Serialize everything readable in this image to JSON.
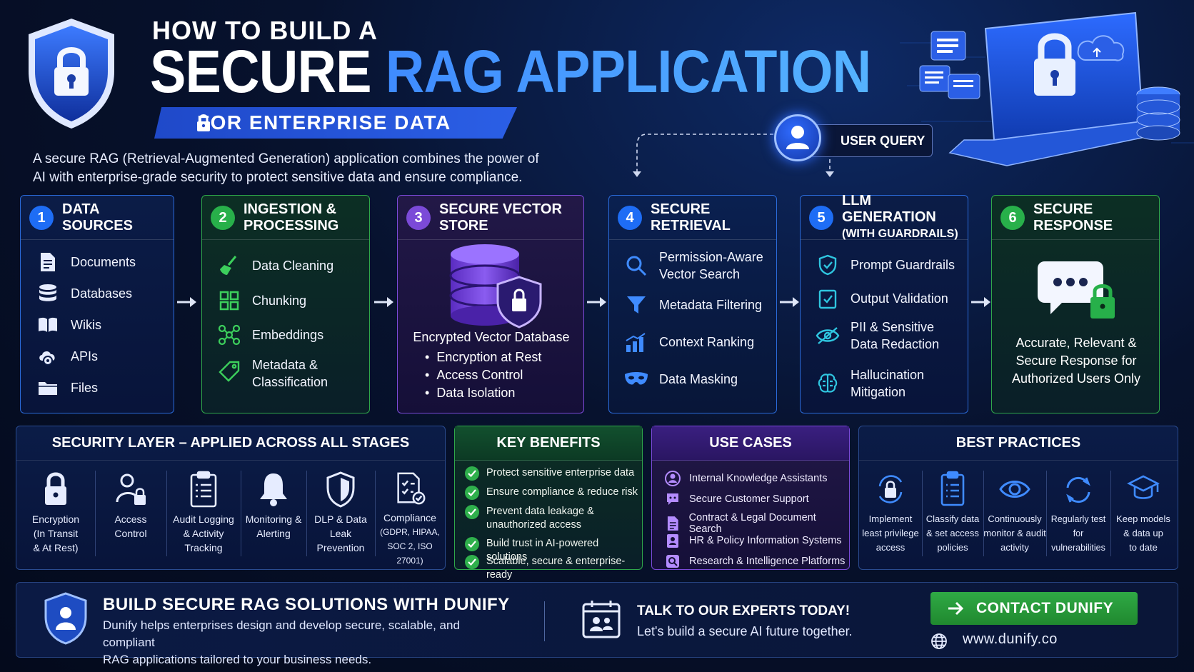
{
  "header": {
    "title_small": "HOW TO BUILD A",
    "title_word1": "SECURE",
    "title_word2": "RAG APPLICATION",
    "subtitle": "FOR ENTERPRISE DATA",
    "intro": "A secure RAG (Retrieval-Augmented Generation) application combines the power of AI with enterprise-grade security to protect sensitive data and ensure compliance."
  },
  "user_query": "USER QUERY",
  "stages": [
    {
      "num": "1",
      "title": "DATA SOURCES",
      "items": [
        "Documents",
        "Databases",
        "Wikis",
        "APIs",
        "Files"
      ]
    },
    {
      "num": "2",
      "title_line1": "INGESTION &",
      "title_line2": "PROCESSING",
      "items": [
        "Data Cleaning",
        "Chunking",
        "Embeddings",
        "Metadata &",
        "Classification"
      ]
    },
    {
      "num": "3",
      "title": "SECURE VECTOR STORE",
      "caption": "Encrypted Vector Database",
      "bullets": [
        "Encryption at Rest",
        "Access Control",
        "Data Isolation"
      ]
    },
    {
      "num": "4",
      "title": "SECURE RETRIEVAL",
      "items": [
        "Permission-Aware",
        "Vector Search",
        "Metadata Filtering",
        "Context Ranking",
        "Data Masking"
      ]
    },
    {
      "num": "5",
      "title_line1": "LLM GENERATION",
      "title_line2": "(WITH GUARDRAILS)",
      "items": [
        "Prompt Guardrails",
        "Output Validation",
        "PII & Sensitive",
        "Data Redaction",
        "Hallucination",
        "Mitigation"
      ]
    },
    {
      "num": "6",
      "title": "SECURE RESPONSE",
      "caption_lines": [
        "Accurate, Relevant &",
        "Secure Response for",
        "Authorized Users Only"
      ]
    }
  ],
  "security_layer": {
    "title": "SECURITY LAYER – APPLIED ACROSS ALL STAGES",
    "items": [
      {
        "lines": [
          "Encryption",
          "(In Transit",
          "& At Rest)"
        ]
      },
      {
        "lines": [
          "Access",
          "Control"
        ]
      },
      {
        "lines": [
          "Audit Logging",
          "& Activity",
          "Tracking"
        ]
      },
      {
        "lines": [
          "Monitoring &",
          "Alerting"
        ]
      },
      {
        "lines": [
          "DLP & Data",
          "Leak Prevention"
        ]
      },
      {
        "lines": [
          "Compliance",
          "(GDPR, HIPAA,",
          "SOC 2, ISO 27001)"
        ]
      }
    ]
  },
  "key_benefits": {
    "title": "KEY BENEFITS",
    "items": [
      [
        "Protect sensitive enterprise data"
      ],
      [
        "Ensure compliance & reduce risk"
      ],
      [
        "Prevent data leakage &",
        "unauthorized access"
      ],
      [
        "Build trust in AI-powered solutions"
      ],
      [
        "Scalable, secure & enterprise-ready"
      ]
    ]
  },
  "use_cases": {
    "title": "USE CASES",
    "items": [
      "Internal Knowledge Assistants",
      "Secure Customer Support",
      "Contract & Legal Document Search",
      "HR & Policy Information Systems",
      "Research & Intelligence Platforms"
    ]
  },
  "best_practices": {
    "title": "BEST PRACTICES",
    "items": [
      {
        "lines": [
          "Implement",
          "least privilege",
          "access"
        ]
      },
      {
        "lines": [
          "Classify data",
          "& set access",
          "policies"
        ]
      },
      {
        "lines": [
          "Continuously",
          "monitor & audit",
          "activity"
        ]
      },
      {
        "lines": [
          "Regularly test",
          "for vulnerabilities"
        ]
      },
      {
        "lines": [
          "Keep models",
          "& data up",
          "to date"
        ]
      }
    ]
  },
  "footer": {
    "title": "BUILD SECURE RAG SOLUTIONS WITH DUNIFY",
    "desc_line1": "Dunify helps enterprises design and develop secure, scalable, and compliant",
    "desc_line2": "RAG applications tailored to your business needs.",
    "talk_title": "TALK TO OUR EXPERTS TODAY!",
    "talk_sub": "Let's build a secure AI future together.",
    "cta": "CONTACT DUNIFY",
    "url": "www.dunify.co"
  },
  "colors": {
    "background": "#040a1c",
    "accent_blue": "#1e6df5",
    "accent_green": "#28b04a",
    "accent_purple": "#7b4ad8",
    "title_gradient_start": "#3f8bff"
  },
  "icons": [
    "shield-lock-icon",
    "lock-icon",
    "laptop-icon",
    "database-icon",
    "cloud-icon",
    "user-icon",
    "document-icon",
    "book-icon",
    "gear-icon",
    "folder-icon",
    "broom-icon",
    "grid-icon",
    "nodes-icon",
    "tag-icon",
    "cylinder-lock-icon",
    "search-icon",
    "funnel-icon",
    "bar-chart-icon",
    "mask-icon",
    "shield-icon",
    "check-clipboard-icon",
    "eye-slash-icon",
    "brain-icon",
    "chat-lock-icon",
    "bell-icon",
    "check-icon",
    "globe-icon",
    "arrow-right-icon",
    "calendar-users-icon",
    "graduation-cap-icon",
    "refresh-icon",
    "eye-icon"
  ]
}
